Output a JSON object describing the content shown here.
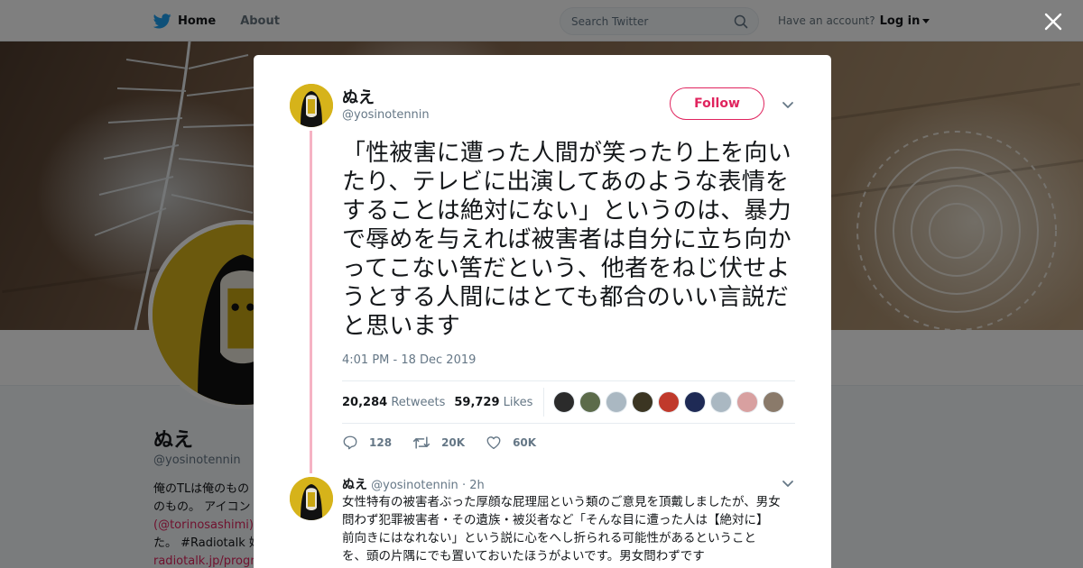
{
  "nav": {
    "home_label": "Home",
    "about_label": "About",
    "search_placeholder": "Search Twitter",
    "account_prompt": "Have an account?",
    "login_label": "Log in"
  },
  "profile": {
    "name": "ぬえ",
    "handle": "@yosinotennin",
    "bio_lines": [
      "俺のTLは俺のもの",
      "のもの。 アイコン",
      "(@torinosashimi)",
      "た。 #Radiotalk 始",
      "radiotalk.jp/progra"
    ]
  },
  "tweet": {
    "author_name": "ぬえ",
    "author_handle": "@yosinotennin",
    "follow_label": "Follow",
    "text": "「性被害に遭った人間が笑ったり上を向いたり、テレビに出演してあのような表情をすることは絶対にない」というのは、暴力で辱めを与えれば被害者は自分に立ち向かってこない筈だという、他者をねじ伏せようとする人間にはとても都合のいい言説だと思います",
    "timestamp": "4:01 PM - 18 Dec 2019",
    "retweets_count": "20,284",
    "retweets_label": "Retweets",
    "likes_count": "59,729",
    "likes_label": "Likes",
    "liker_colors": [
      "#2b2b2b",
      "#5c6b4a",
      "#aab8c2",
      "#3b3522",
      "#c0392b",
      "#1e2a55",
      "#aab8c2",
      "#d8a0a0",
      "#8a7a6a"
    ],
    "reply_count": "128",
    "retweet_count": "20K",
    "like_count": "60K"
  },
  "reply": {
    "author_name": "ぬえ",
    "author_handle": "@yosinotennin",
    "time": "· 2h",
    "lines": [
      "女性特有の被害者ぶった厚顔な屁理屈という類のご意見を頂戴しましたが、男女",
      "問わず犯罪被害者・その遺族・被災者など「そんな目に遭った人は【絶対に】",
      "前向きにはなれない」という説に心をへし折られる可能性があるということ",
      "を、頭の片隅にでも置いておいたほうがよいです。男女問わずです"
    ]
  },
  "colors": {
    "accent": "#e0245e",
    "twitter_blue": "#1da1f2",
    "thread_line": "#f6b3c4",
    "avatar_yellow": "#d6b31a"
  },
  "icons": [
    "twitter-bird-icon",
    "search-icon",
    "close-icon",
    "chevron-down-icon",
    "reply-icon",
    "retweet-icon",
    "heart-icon"
  ]
}
